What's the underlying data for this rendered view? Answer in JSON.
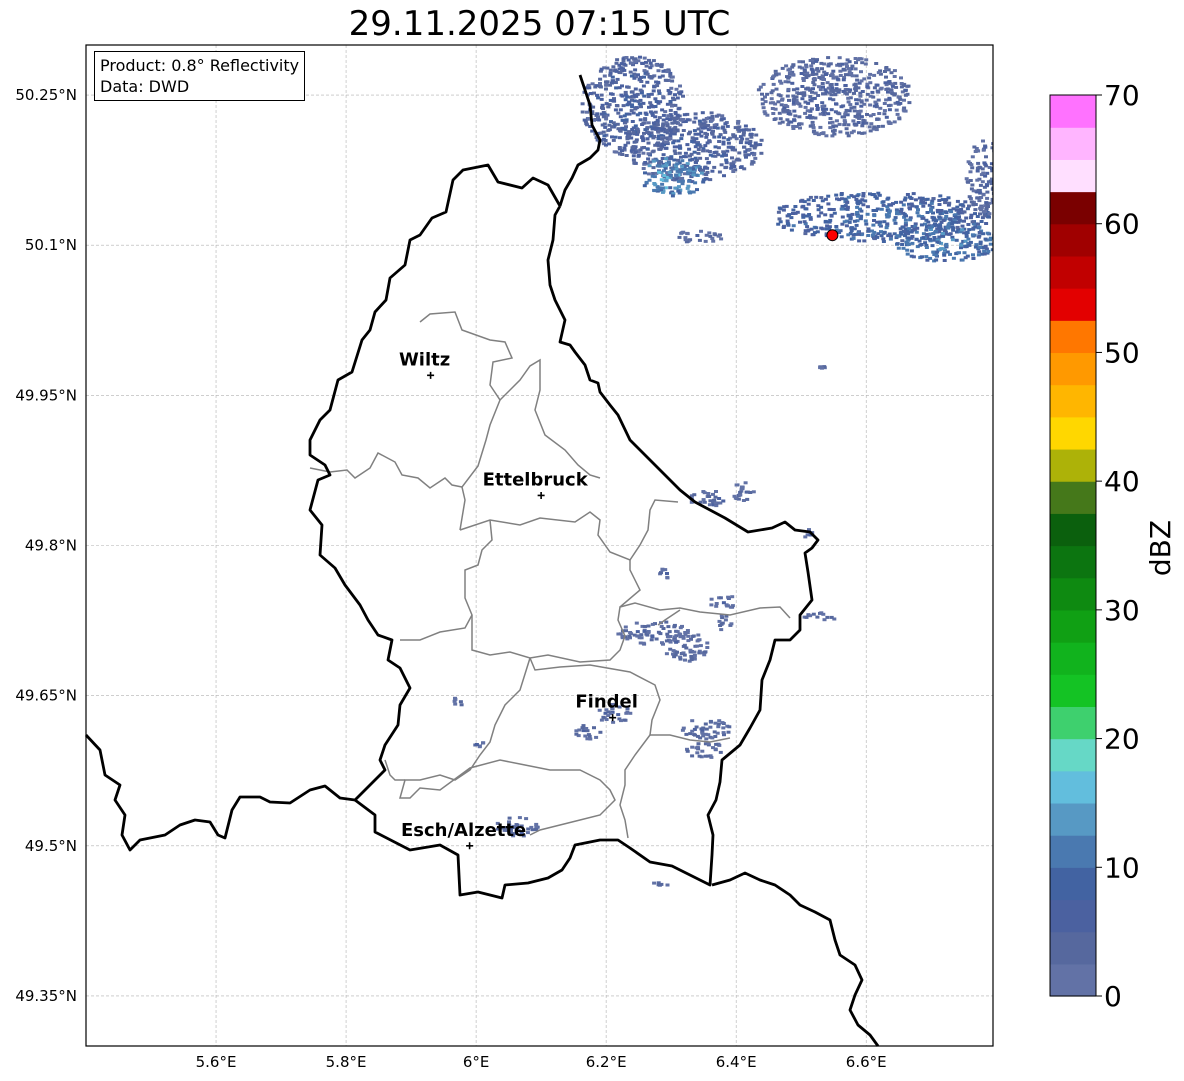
{
  "title": "29.11.2025 07:15 UTC",
  "info": {
    "product": "Product: 0.8° Reflectivity",
    "data": "Data: DWD"
  },
  "lat_ticks": [
    {
      "value": 50.25,
      "label": "50.25°N"
    },
    {
      "value": 50.1,
      "label": "50.1°N"
    },
    {
      "value": 49.95,
      "label": "49.95°N"
    },
    {
      "value": 49.8,
      "label": "49.8°N"
    },
    {
      "value": 49.65,
      "label": "49.65°N"
    },
    {
      "value": 49.5,
      "label": "49.5°N"
    },
    {
      "value": 49.35,
      "label": "49.35°N"
    }
  ],
  "lon_ticks": [
    {
      "value": 5.6,
      "label": "5.6°E"
    },
    {
      "value": 5.8,
      "label": "5.8°E"
    },
    {
      "value": 6.0,
      "label": "6°E"
    },
    {
      "value": 6.2,
      "label": "6.2°E"
    },
    {
      "value": 6.4,
      "label": "6.4°E"
    },
    {
      "value": 6.6,
      "label": "6.6°E"
    }
  ],
  "extent": {
    "lon_min": 5.4,
    "lon_max": 6.795,
    "lat_min": 49.3,
    "lat_max": 50.3
  },
  "cities": [
    {
      "name": "Wiltz",
      "lon": 5.93,
      "lat": 49.97
    },
    {
      "name": "Ettelbruck",
      "lon": 6.1,
      "lat": 49.85
    },
    {
      "name": "Findel",
      "lon": 6.21,
      "lat": 49.628
    },
    {
      "name": "Esch/Alzette",
      "lon": 5.99,
      "lat": 49.5
    }
  ],
  "radar_site": {
    "lon": 6.548,
    "lat": 50.11,
    "color": "#ff0000"
  },
  "colorbar": {
    "label": "dBZ",
    "ticks": [
      "0",
      "10",
      "20",
      "30",
      "40",
      "50",
      "60",
      "70"
    ],
    "min": 0,
    "max": 70,
    "step": 2.5,
    "colors": [
      "#6272a6",
      "#56689e",
      "#4b61a0",
      "#4263a2",
      "#4a79b0",
      "#5799c4",
      "#62bedd",
      "#66d8c6",
      "#3ed06e",
      "#14c324",
      "#11b31d",
      "#10a014",
      "#0e8a11",
      "#0c7510",
      "#0b600d",
      "#45781a",
      "#adb208",
      "#ffd700",
      "#ffb600",
      "#ff9900",
      "#ff7700",
      "#e30000",
      "#c10000",
      "#a00000",
      "#7a0000",
      "#ffdfff",
      "#ffb5ff",
      "#ff72ff",
      "#ee33ee"
    ]
  },
  "echoes": [
    {
      "lon": 6.33,
      "lat": 50.2,
      "rx": 0.11,
      "ry": 0.035,
      "dbz": 7
    },
    {
      "lon": 6.24,
      "lat": 50.24,
      "rx": 0.08,
      "ry": 0.05,
      "dbz": 7
    },
    {
      "lon": 6.55,
      "lat": 50.25,
      "rx": 0.12,
      "ry": 0.04,
      "dbz": 5
    },
    {
      "lon": 6.62,
      "lat": 50.13,
      "rx": 0.17,
      "ry": 0.025,
      "dbz": 10
    },
    {
      "lon": 6.72,
      "lat": 50.105,
      "rx": 0.08,
      "ry": 0.02,
      "dbz": 12
    },
    {
      "lon": 6.3,
      "lat": 50.17,
      "rx": 0.05,
      "ry": 0.02,
      "dbz": 14
    },
    {
      "lon": 6.78,
      "lat": 50.17,
      "rx": 0.03,
      "ry": 0.04,
      "dbz": 5
    },
    {
      "lon": 6.36,
      "lat": 49.848,
      "rx": 0.035,
      "ry": 0.008,
      "dbz": 5
    },
    {
      "lon": 6.41,
      "lat": 49.855,
      "rx": 0.02,
      "ry": 0.01,
      "dbz": 4
    },
    {
      "lon": 6.27,
      "lat": 49.714,
      "rx": 0.055,
      "ry": 0.012,
      "dbz": 4
    },
    {
      "lon": 6.32,
      "lat": 49.7,
      "rx": 0.035,
      "ry": 0.015,
      "dbz": 4
    },
    {
      "lon": 6.38,
      "lat": 49.745,
      "rx": 0.025,
      "ry": 0.006,
      "dbz": 4
    },
    {
      "lon": 6.38,
      "lat": 49.725,
      "rx": 0.01,
      "ry": 0.01,
      "dbz": 4
    },
    {
      "lon": 6.53,
      "lat": 49.731,
      "rx": 0.03,
      "ry": 0.004,
      "dbz": 5
    },
    {
      "lon": 6.29,
      "lat": 49.774,
      "rx": 0.014,
      "ry": 0.005,
      "dbz": 4
    },
    {
      "lon": 6.21,
      "lat": 49.633,
      "rx": 0.025,
      "ry": 0.01,
      "dbz": 4
    },
    {
      "lon": 6.17,
      "lat": 49.615,
      "rx": 0.02,
      "ry": 0.008,
      "dbz": 4
    },
    {
      "lon": 6.35,
      "lat": 49.618,
      "rx": 0.04,
      "ry": 0.01,
      "dbz": 4
    },
    {
      "lon": 6.35,
      "lat": 49.597,
      "rx": 0.03,
      "ry": 0.008,
      "dbz": 4
    },
    {
      "lon": 6.06,
      "lat": 49.52,
      "rx": 0.035,
      "ry": 0.01,
      "dbz": 4
    },
    {
      "lon": 5.97,
      "lat": 49.647,
      "rx": 0.008,
      "ry": 0.006,
      "dbz": 4
    },
    {
      "lon": 6.0,
      "lat": 49.602,
      "rx": 0.01,
      "ry": 0.004,
      "dbz": 4
    },
    {
      "lon": 6.28,
      "lat": 49.462,
      "rx": 0.015,
      "ry": 0.003,
      "dbz": 4
    },
    {
      "lon": 6.51,
      "lat": 49.812,
      "rx": 0.008,
      "ry": 0.006,
      "dbz": 4
    },
    {
      "lon": 6.53,
      "lat": 49.98,
      "rx": 0.005,
      "ry": 0.004,
      "dbz": 4
    },
    {
      "lon": 6.34,
      "lat": 50.11,
      "rx": 0.04,
      "ry": 0.006,
      "dbz": 4
    }
  ]
}
